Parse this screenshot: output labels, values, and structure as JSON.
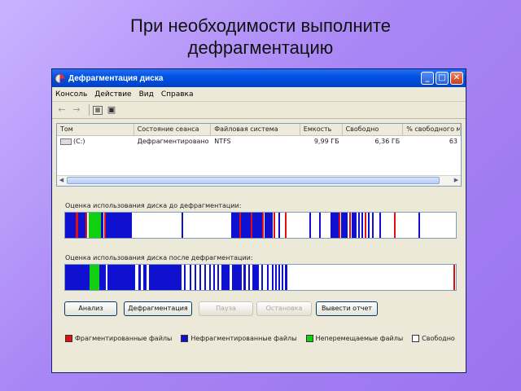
{
  "slide": {
    "title": "При необходимости выполните дефрагментацию"
  },
  "window": {
    "title": "Дефрагментация диска",
    "controls": {
      "minimize": "_",
      "maximize": "□",
      "close": "✕"
    }
  },
  "menu": [
    "Консоль",
    "Действие",
    "Вид",
    "Справка"
  ],
  "toolbar": [
    "back-arrow-icon",
    "forward-arrow-icon",
    "console-tree-icon",
    "help-icon"
  ],
  "volumes": {
    "columns": [
      "Том",
      "Состояние сеанса",
      "Файловая система",
      "Емкость",
      "Свободно",
      "% свободного места"
    ],
    "rows": [
      [
        "(C:)",
        "Дефрагментировано",
        "NTFS",
        "9,99 ГБ",
        "6,36 ГБ",
        "63"
      ]
    ]
  },
  "analysis": {
    "before_label": "Оценка использования диска до дефрагментации:",
    "after_label": "Оценка использования диска после дефрагментации:"
  },
  "buttons": {
    "analyze": "Анализ",
    "defragment": "Дефрагментация",
    "pause": "Пауза",
    "stop": "Остановка",
    "report": "Вывести отчет"
  },
  "legend": [
    {
      "label": "Фрагментированные файлы",
      "color": "#e01010"
    },
    {
      "label": "Нефрагментированные файлы",
      "color": "#1010d0"
    },
    {
      "label": "Неперемещаемые файлы",
      "color": "#10d010"
    },
    {
      "label": "Свободно",
      "color": "#ffffff"
    }
  ]
}
